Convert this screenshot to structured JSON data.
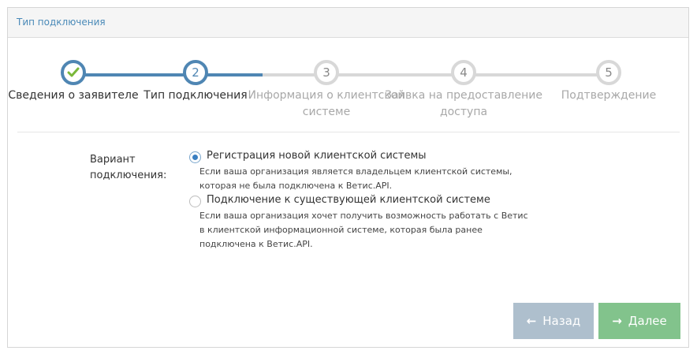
{
  "panel": {
    "title": "Тип подключения"
  },
  "wizard": {
    "steps": [
      {
        "number": "",
        "icon": "checkmark-icon",
        "label": "Сведения о заявителе",
        "state": "done"
      },
      {
        "number": "2",
        "label": "Тип подключения",
        "state": "active"
      },
      {
        "number": "3",
        "label": "Информация о клиентской системе",
        "state": "todo"
      },
      {
        "number": "4",
        "label": "Заявка на предоставление доступа",
        "state": "todo"
      },
      {
        "number": "5",
        "label": "Подтверждение",
        "state": "todo"
      }
    ]
  },
  "form": {
    "field_label": "Вариант подключения:",
    "options": [
      {
        "title": "Регистрация новой клиентской системы",
        "description": "Если ваша организация является владельцем клиентской системы, которая не была подключена к Ветис.API.",
        "checked": true
      },
      {
        "title": "Подключение к существующей клиентской системе",
        "description": "Если ваша организация хочет получить возможность работать с Ветис в клиентской информационной системе, которая была ранее подключена к Ветис.API.",
        "checked": false
      }
    ]
  },
  "actions": {
    "back_label": "Назад",
    "next_label": "Далее",
    "back_icon": "arrow-left-icon",
    "next_icon": "arrow-right-icon"
  },
  "colors": {
    "accent": "#4f86b3",
    "check": "#7ab83a",
    "back_button": "#aebfcd",
    "next_button": "#82c38c"
  }
}
